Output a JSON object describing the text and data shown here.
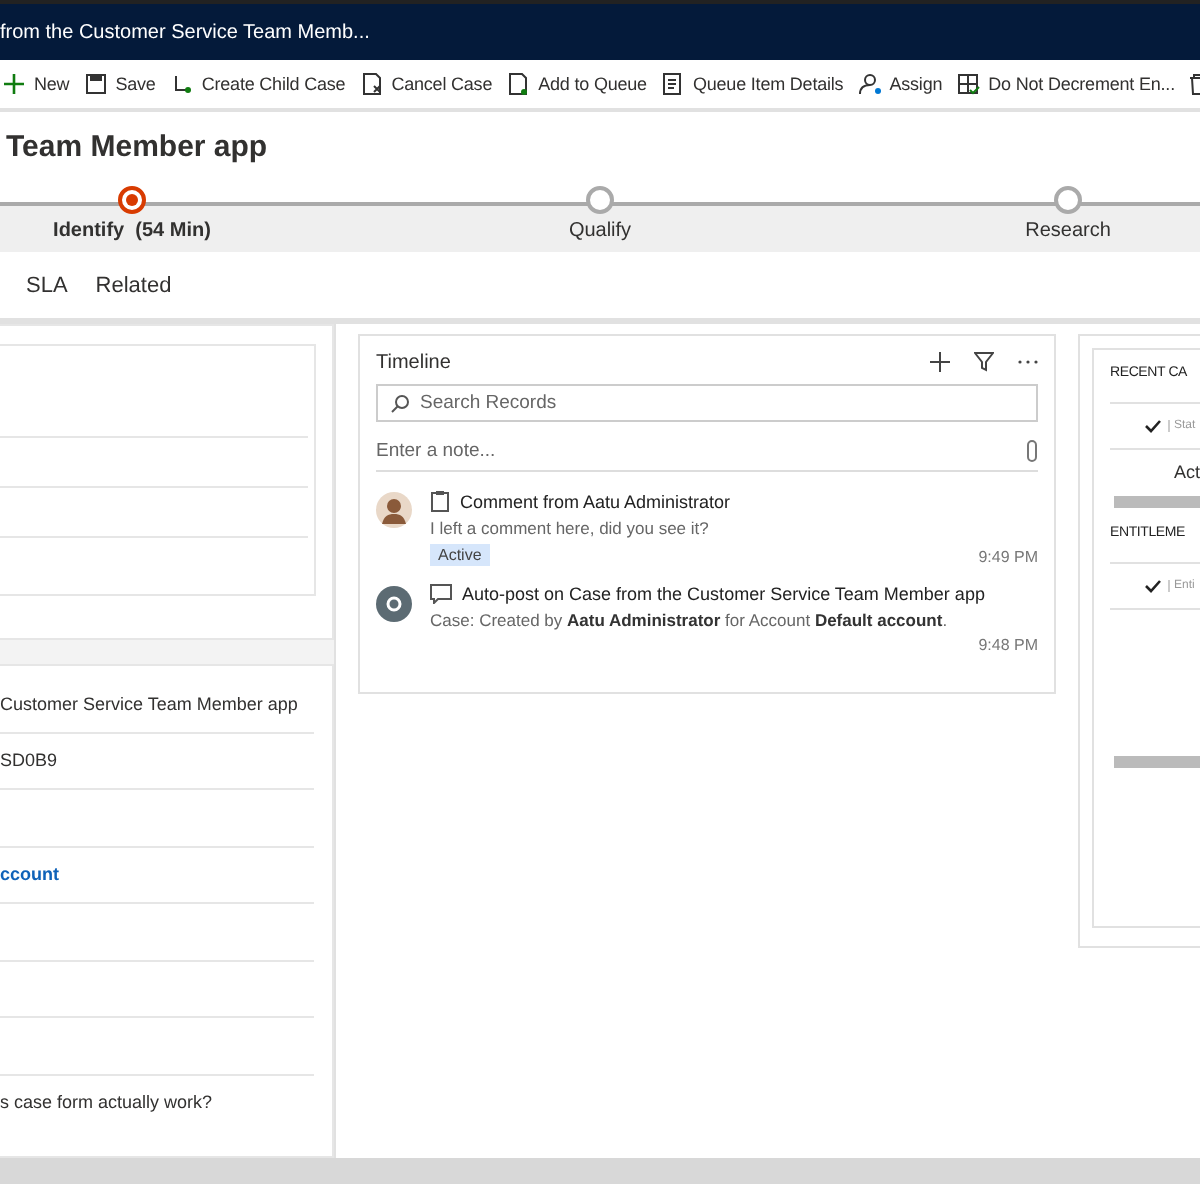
{
  "title_bar": {
    "title": "from the Customer Service Team Memb..."
  },
  "commands": [
    {
      "label": "New"
    },
    {
      "label": "Save"
    },
    {
      "label": "Create Child Case"
    },
    {
      "label": "Cancel Case"
    },
    {
      "label": "Add to Queue"
    },
    {
      "label": "Queue Item Details"
    },
    {
      "label": "Assign"
    },
    {
      "label": "Do Not Decrement En..."
    }
  ],
  "record_title": "Team Member app",
  "process": {
    "stages": [
      {
        "label": "Identify",
        "duration": "(54 Min)",
        "selected": true
      },
      {
        "label": "Qualify",
        "selected": false
      },
      {
        "label": "Research",
        "selected": false
      }
    ]
  },
  "tabs": [
    {
      "label": "SLA"
    },
    {
      "label": "Related"
    }
  ],
  "form_card": {
    "rows": [
      {
        "kind": "text",
        "value": "Customer Service Team Member app"
      },
      {
        "kind": "text",
        "value": "SD0B9"
      },
      {
        "kind": "blank"
      },
      {
        "kind": "link",
        "value": "ccount"
      },
      {
        "kind": "blank"
      },
      {
        "kind": "blank"
      },
      {
        "kind": "blank"
      },
      {
        "kind": "text",
        "value": "s case form actually work?"
      }
    ]
  },
  "timeline": {
    "title": "Timeline",
    "search": {
      "placeholder": "Search Records"
    },
    "note": {
      "placeholder": "Enter a note..."
    },
    "entries": [
      {
        "kind": "comment",
        "title": "Comment from Aatu Administrator",
        "body": "I left a comment here, did you see it?",
        "badge": "Active",
        "time": "9:49 PM"
      },
      {
        "kind": "auto_post",
        "title": "Auto-post on Case from the Customer Service Team Member app",
        "body": "Case: Created by **Aatu Administrator** for Account **Default account**.",
        "time": "9:48 PM"
      }
    ]
  },
  "side_panel": {
    "sections": [
      {
        "title": "RECENT CA",
        "column": "Stat",
        "cell": "Act"
      },
      {
        "title": "ENTITLEME",
        "column": "Enti"
      }
    ]
  }
}
